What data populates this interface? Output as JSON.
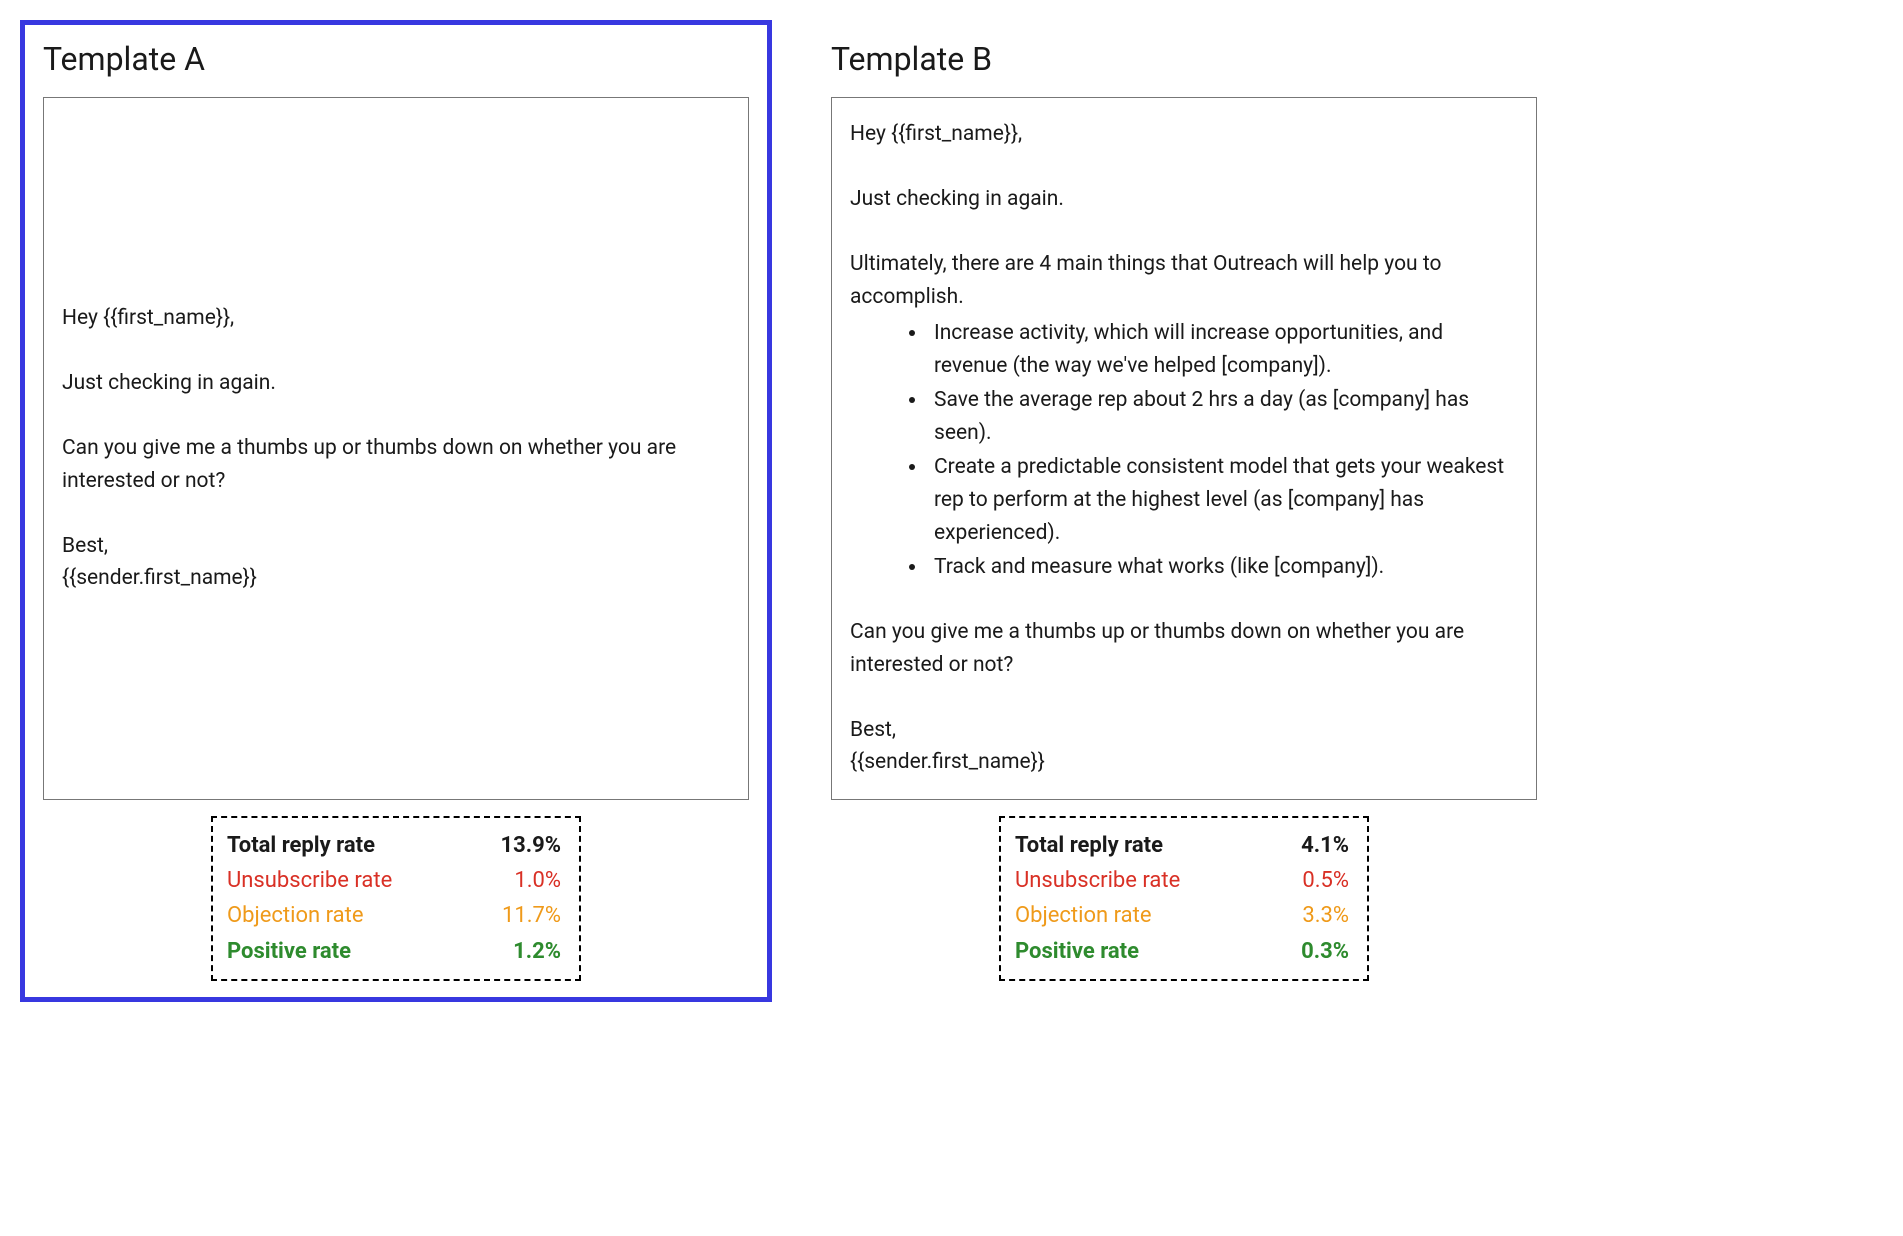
{
  "colors": {
    "selected_border": "#3838e0",
    "red": "#d93025",
    "orange": "#ef9a1a",
    "green": "#2e8b2e"
  },
  "templates": [
    {
      "id": "A",
      "title": "Template A",
      "selected": true,
      "body": {
        "greeting": "Hey {{first_name}},",
        "intro": "Just checking in again.",
        "followup": "Can you give me a thumbs up or thumbs down on whether you are interested or not?",
        "signoff": "Best,",
        "sender": "{{sender.first_name}}",
        "has_list": false
      },
      "stats": {
        "total_reply_label": "Total reply rate",
        "total_reply_value": "13.9%",
        "unsub_label": "Unsubscribe rate",
        "unsub_value": "1.0%",
        "objection_label": "Objection rate",
        "objection_value": "11.7%",
        "positive_label": "Positive rate",
        "positive_value": "1.2%"
      }
    },
    {
      "id": "B",
      "title": "Template B",
      "selected": false,
      "body": {
        "greeting": "Hey {{first_name}},",
        "intro": "Just checking in again.",
        "lead": "Ultimately, there are 4 main things that Outreach will help you to accomplish.",
        "bullets": [
          "Increase activity, which will increase opportunities, and revenue (the way we've helped [company]).",
          "Save the average rep about 2 hrs a day (as [company] has seen).",
          "Create a predictable consistent model that gets your weakest rep to perform at the highest level (as [company] has experienced).",
          "Track and measure what works (like [company])."
        ],
        "followup": "Can you give me a thumbs up or thumbs down on whether you are interested or not?",
        "signoff": "Best,",
        "sender": "{{sender.first_name}}",
        "has_list": true
      },
      "stats": {
        "total_reply_label": "Total reply rate",
        "total_reply_value": "4.1%",
        "unsub_label": "Unsubscribe rate",
        "unsub_value": "0.5%",
        "objection_label": "Objection rate",
        "objection_value": "3.3%",
        "positive_label": "Positive rate",
        "positive_value": "0.3%"
      }
    }
  ]
}
